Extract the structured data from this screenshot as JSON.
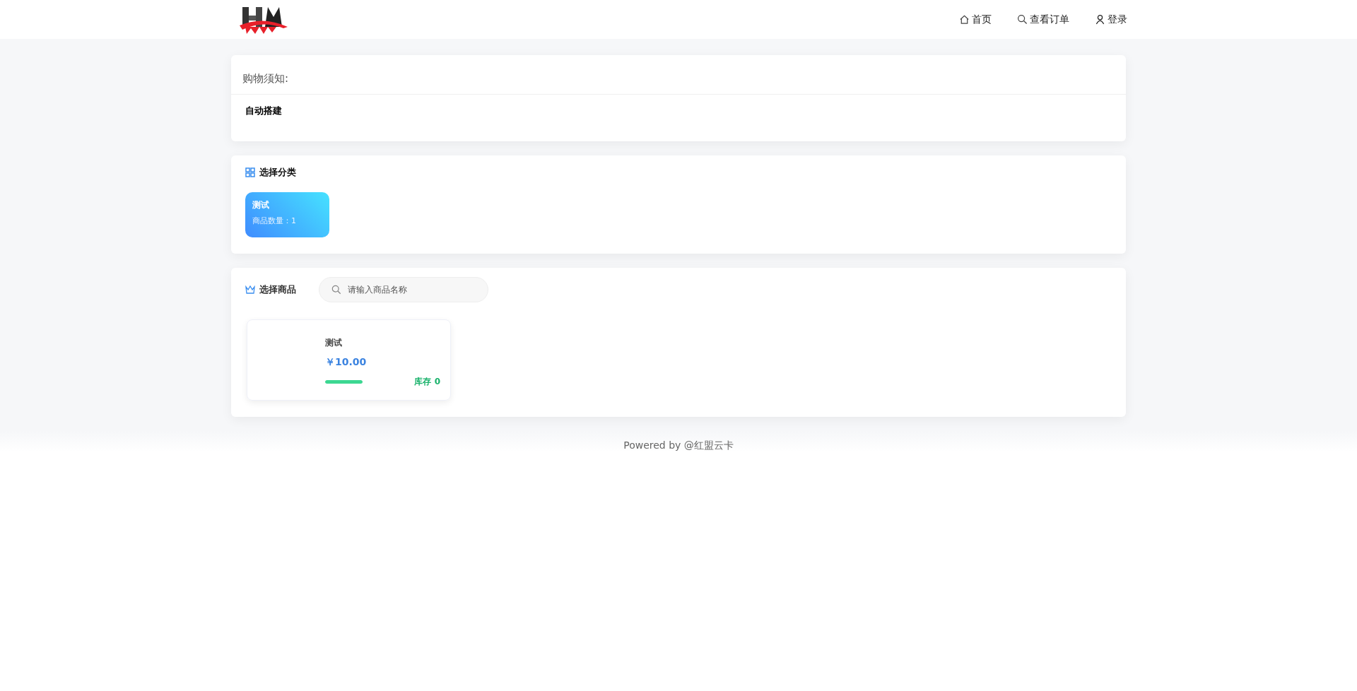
{
  "nav": [
    {
      "kind": "home",
      "label": "首页"
    },
    {
      "kind": "search",
      "label": "查看订单"
    },
    {
      "kind": "user",
      "label": "登录"
    }
  ],
  "notice": {
    "title": "购物须知:",
    "body": "自动搭建"
  },
  "categories": {
    "title": "选择分类",
    "items": [
      {
        "name": "测试",
        "count": "商品数量：1",
        "selected": true
      }
    ]
  },
  "products": {
    "title": "选择商品",
    "search": {
      "placeholder": "请输入商品名称"
    },
    "items": [
      {
        "name": "测试",
        "price": "￥10.00",
        "level": 1,
        "stock": "库存 0"
      }
    ]
  },
  "footer": "Powered by @红盟云卡"
}
